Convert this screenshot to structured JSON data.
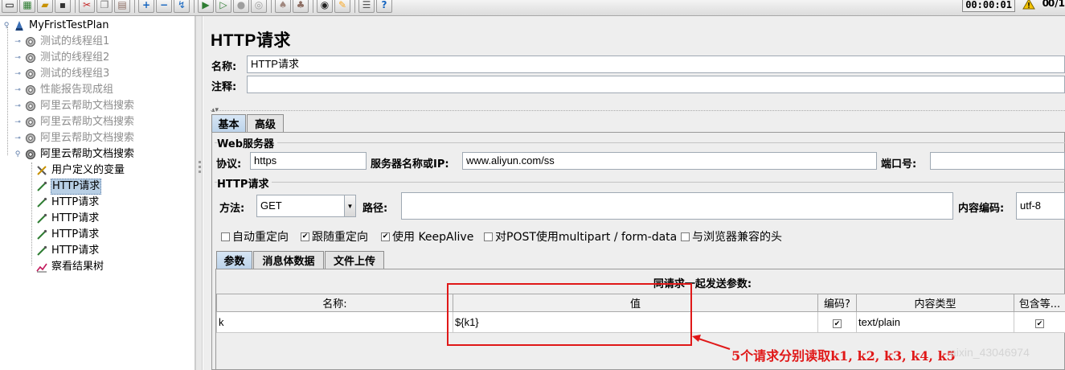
{
  "toolbar": {
    "timer": "00:00:01",
    "warning_count": "0",
    "thread_count": "0/1",
    "icons": [
      "new-icon",
      "templates-icon",
      "open-icon",
      "save-icon",
      "cut-icon",
      "copy-icon",
      "paste-icon",
      "expand-icon",
      "collapse-icon",
      "toggle-icon",
      "start-icon",
      "start-no-pause-icon",
      "stop-icon",
      "shutdown-icon",
      "clear-icon",
      "clear-all-icon",
      "search-icon",
      "reset-search-icon",
      "function-helper-icon",
      "help-icon"
    ]
  },
  "tree": {
    "root": "MyFristTestPlan",
    "thread_groups": [
      {
        "label": "测试的线程组1",
        "enabled": false
      },
      {
        "label": "测试的线程组2",
        "enabled": false
      },
      {
        "label": "测试的线程组3",
        "enabled": false
      },
      {
        "label": "性能报告现成组",
        "enabled": false
      },
      {
        "label": "阿里云帮助文档搜索",
        "enabled": false
      },
      {
        "label": "阿里云帮助文档搜索",
        "enabled": false
      },
      {
        "label": "阿里云帮助文档搜索",
        "enabled": false
      },
      {
        "label": "阿里云帮助文档搜索",
        "enabled": true
      }
    ],
    "children": [
      {
        "label": "用户定义的变量"
      },
      {
        "label": "HTTP请求"
      },
      {
        "label": "HTTP请求"
      },
      {
        "label": "HTTP请求"
      },
      {
        "label": "HTTP请求"
      },
      {
        "label": "HTTP请求"
      },
      {
        "label": "察看结果树"
      }
    ]
  },
  "main": {
    "title": "HTTP请求",
    "name_label": "名称:",
    "name_value": "HTTP请求",
    "comment_label": "注释:",
    "comment_value": "",
    "tabs": [
      "基本",
      "高级"
    ],
    "web_server": {
      "title": "Web服务器",
      "protocol_label": "协议:",
      "protocol_value": "https",
      "server_label": "服务器名称或IP:",
      "server_value": "www.aliyun.com/ss",
      "port_label": "端口号:",
      "port_value": ""
    },
    "http_request": {
      "title": "HTTP请求",
      "method_label": "方法:",
      "method_value": "GET",
      "path_label": "路径:",
      "path_value": "",
      "encoding_label": "内容编码:",
      "encoding_value": "utf-8"
    },
    "options": [
      {
        "label": "自动重定向",
        "checked": false
      },
      {
        "label": "跟随重定向",
        "checked": true
      },
      {
        "label": "使用 KeepAlive",
        "checked": true
      },
      {
        "label": "对POST使用multipart / form-data",
        "checked": false
      },
      {
        "label": "与浏览器兼容的头",
        "checked": false
      }
    ],
    "sub_tabs": [
      "参数",
      "消息体数据",
      "文件上传"
    ],
    "params": {
      "caption": "同请求一起发送参数:",
      "headers": [
        "名称:",
        "值",
        "编码?",
        "内容类型",
        "包含等..."
      ],
      "rows": [
        {
          "name": "k",
          "value": "${k1}",
          "encode": true,
          "content_type": "text/plain",
          "include_equals": true
        }
      ]
    }
  },
  "annotation": {
    "text": "5个请求分别读取k1, k2, k3, k4, k5",
    "color": "#e01818"
  },
  "watermark": "aixin_43046974"
}
